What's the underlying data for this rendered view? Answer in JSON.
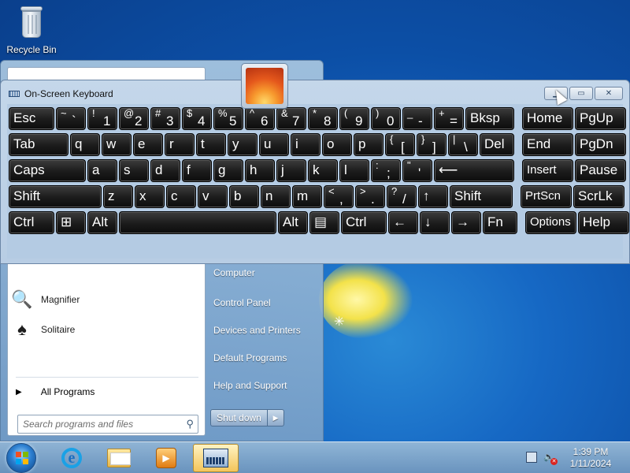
{
  "desktop": {
    "icons": [
      {
        "label": "Recycle Bin",
        "icon": "recycle-bin-icon"
      }
    ]
  },
  "start_menu": {
    "programs": [
      {
        "label": "Magnifier",
        "icon": "magnifier-icon"
      },
      {
        "label": "Solitaire",
        "icon": "solitaire-icon"
      }
    ],
    "all_programs": "All Programs",
    "search_placeholder": "Search programs and files",
    "right_items": [
      "Computer",
      "Control Panel",
      "Devices and Printers",
      "Default Programs",
      "Help and Support"
    ],
    "shutdown": "Shut down"
  },
  "osk": {
    "title": "On-Screen Keyboard",
    "window_buttons": [
      "minimize",
      "restore",
      "close"
    ],
    "rows": [
      [
        {
          "main": "Esc"
        },
        {
          "sup": "~",
          "main": "`"
        },
        {
          "sup": "!",
          "main": "1"
        },
        {
          "sup": "@",
          "main": "2"
        },
        {
          "sup": "#",
          "main": "3"
        },
        {
          "sup": "$",
          "main": "4"
        },
        {
          "sup": "%",
          "main": "5"
        },
        {
          "sup": "^",
          "main": "6"
        },
        {
          "sup": "&",
          "main": "7"
        },
        {
          "sup": "*",
          "main": "8"
        },
        {
          "sup": "(",
          "main": "9"
        },
        {
          "sup": ")",
          "main": "0"
        },
        {
          "sup": "_",
          "main": "-"
        },
        {
          "sup": "+",
          "main": "="
        },
        {
          "main": "Bksp"
        },
        {
          "main": "Home"
        },
        {
          "main": "PgUp"
        }
      ],
      [
        {
          "main": "Tab"
        },
        {
          "main": "q"
        },
        {
          "main": "w"
        },
        {
          "main": "e"
        },
        {
          "main": "r"
        },
        {
          "main": "t"
        },
        {
          "main": "y"
        },
        {
          "main": "u"
        },
        {
          "main": "i"
        },
        {
          "main": "o"
        },
        {
          "main": "p"
        },
        {
          "sup": "{",
          "main": "["
        },
        {
          "sup": "}",
          "main": "]"
        },
        {
          "sup": "|",
          "main": "\\"
        },
        {
          "main": "Del"
        },
        {
          "main": "End"
        },
        {
          "main": "PgDn"
        }
      ],
      [
        {
          "main": "Caps"
        },
        {
          "main": "a"
        },
        {
          "main": "s"
        },
        {
          "main": "d"
        },
        {
          "main": "f"
        },
        {
          "main": "g"
        },
        {
          "main": "h"
        },
        {
          "main": "j"
        },
        {
          "main": "k"
        },
        {
          "main": "l"
        },
        {
          "sup": ":",
          "main": ";"
        },
        {
          "sup": "\"",
          "main": "'"
        },
        {
          "main": "⟵"
        },
        {
          "main": "Insert"
        },
        {
          "main": "Pause"
        }
      ],
      [
        {
          "main": "Shift"
        },
        {
          "main": "z"
        },
        {
          "main": "x"
        },
        {
          "main": "c"
        },
        {
          "main": "v"
        },
        {
          "main": "b"
        },
        {
          "main": "n"
        },
        {
          "main": "m"
        },
        {
          "sup": "<",
          "main": ","
        },
        {
          "sup": ">",
          "main": "."
        },
        {
          "sup": "?",
          "main": "/"
        },
        {
          "main": "↑"
        },
        {
          "main": "Shift"
        },
        {
          "main": "PrtScn"
        },
        {
          "main": "ScrLk"
        }
      ],
      [
        {
          "main": "Ctrl"
        },
        {
          "main": "⊞"
        },
        {
          "main": "Alt"
        },
        {
          "main": ""
        },
        {
          "main": "Alt"
        },
        {
          "main": "▤"
        },
        {
          "main": "Ctrl"
        },
        {
          "main": "←"
        },
        {
          "main": "↓"
        },
        {
          "main": "→"
        },
        {
          "main": "Fn"
        },
        {
          "main": "Options"
        },
        {
          "main": "Help"
        }
      ]
    ]
  },
  "taskbar": {
    "pinned": [
      {
        "name": "internet-explorer",
        "icon": "ie-icon"
      },
      {
        "name": "windows-explorer",
        "icon": "folder-icon"
      },
      {
        "name": "media-player",
        "icon": "media-player-icon"
      },
      {
        "name": "on-screen-keyboard",
        "icon": "keyboard-icon",
        "active": true
      }
    ],
    "time": "1:39 PM",
    "date": "1/11/2024"
  }
}
